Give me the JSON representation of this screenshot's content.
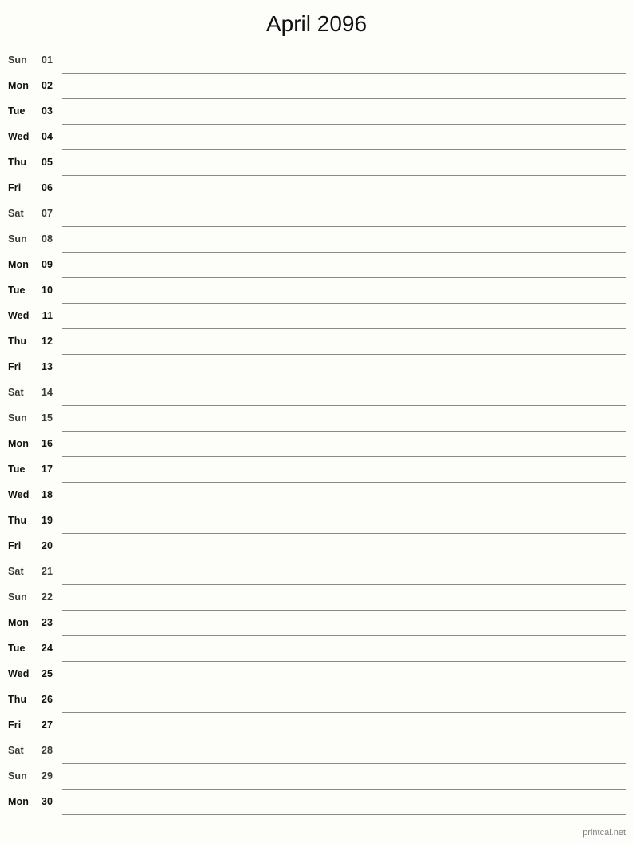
{
  "page": {
    "title": "April 2096",
    "background_color": "#fdfdfa",
    "rule_color": "#8a8a8a",
    "text_color": "#111111",
    "weekend_text_color": "#3a3a3a"
  },
  "footer": {
    "label": "printcal.net",
    "color": "#808080"
  },
  "calendar": {
    "month": "April",
    "year": "2096",
    "rows": [
      {
        "dow": "Sun",
        "date": "01",
        "weekend": true
      },
      {
        "dow": "Mon",
        "date": "02",
        "weekend": false
      },
      {
        "dow": "Tue",
        "date": "03",
        "weekend": false
      },
      {
        "dow": "Wed",
        "date": "04",
        "weekend": false
      },
      {
        "dow": "Thu",
        "date": "05",
        "weekend": false
      },
      {
        "dow": "Fri",
        "date": "06",
        "weekend": false
      },
      {
        "dow": "Sat",
        "date": "07",
        "weekend": true
      },
      {
        "dow": "Sun",
        "date": "08",
        "weekend": true
      },
      {
        "dow": "Mon",
        "date": "09",
        "weekend": false
      },
      {
        "dow": "Tue",
        "date": "10",
        "weekend": false
      },
      {
        "dow": "Wed",
        "date": "11",
        "weekend": false
      },
      {
        "dow": "Thu",
        "date": "12",
        "weekend": false
      },
      {
        "dow": "Fri",
        "date": "13",
        "weekend": false
      },
      {
        "dow": "Sat",
        "date": "14",
        "weekend": true
      },
      {
        "dow": "Sun",
        "date": "15",
        "weekend": true
      },
      {
        "dow": "Mon",
        "date": "16",
        "weekend": false
      },
      {
        "dow": "Tue",
        "date": "17",
        "weekend": false
      },
      {
        "dow": "Wed",
        "date": "18",
        "weekend": false
      },
      {
        "dow": "Thu",
        "date": "19",
        "weekend": false
      },
      {
        "dow": "Fri",
        "date": "20",
        "weekend": false
      },
      {
        "dow": "Sat",
        "date": "21",
        "weekend": true
      },
      {
        "dow": "Sun",
        "date": "22",
        "weekend": true
      },
      {
        "dow": "Mon",
        "date": "23",
        "weekend": false
      },
      {
        "dow": "Tue",
        "date": "24",
        "weekend": false
      },
      {
        "dow": "Wed",
        "date": "25",
        "weekend": false
      },
      {
        "dow": "Thu",
        "date": "26",
        "weekend": false
      },
      {
        "dow": "Fri",
        "date": "27",
        "weekend": false
      },
      {
        "dow": "Sat",
        "date": "28",
        "weekend": true
      },
      {
        "dow": "Sun",
        "date": "29",
        "weekend": true
      },
      {
        "dow": "Mon",
        "date": "30",
        "weekend": false
      }
    ]
  }
}
